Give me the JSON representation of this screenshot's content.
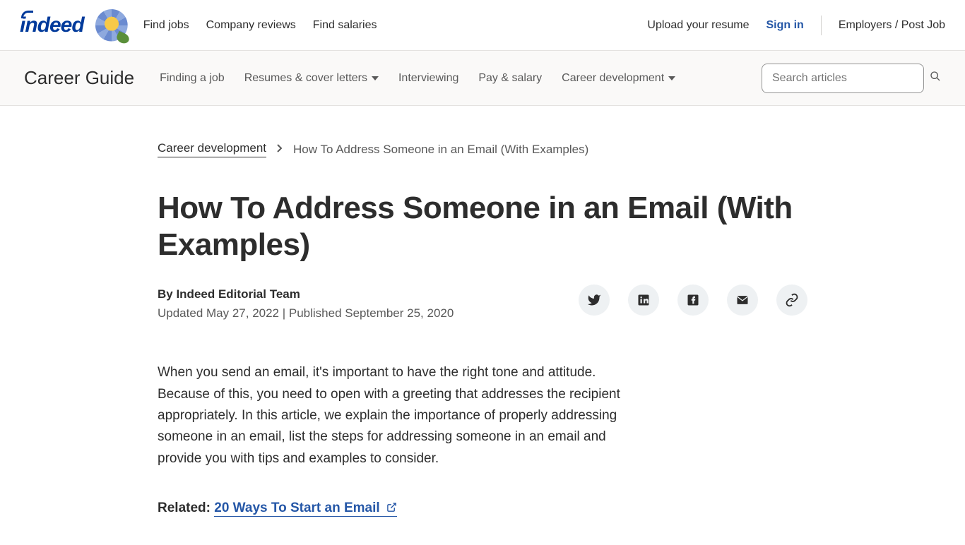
{
  "topNav": {
    "links": [
      "Find jobs",
      "Company reviews",
      "Find salaries"
    ],
    "upload": "Upload your resume",
    "signin": "Sign in",
    "employers": "Employers / Post Job"
  },
  "subNav": {
    "title": "Career Guide",
    "links": [
      {
        "label": "Finding a job",
        "dropdown": false
      },
      {
        "label": "Resumes & cover letters",
        "dropdown": true
      },
      {
        "label": "Interviewing",
        "dropdown": false
      },
      {
        "label": "Pay & salary",
        "dropdown": false
      },
      {
        "label": "Career development",
        "dropdown": true
      }
    ],
    "searchPlaceholder": "Search articles"
  },
  "breadcrumb": {
    "parent": "Career development",
    "current": "How To Address Someone in an Email (With Examples)"
  },
  "article": {
    "title": "How To Address Someone in an Email (With Examples)",
    "byline": "By Indeed Editorial Team",
    "dates": "Updated May 27, 2022 | Published September 25, 2020",
    "body": "When you send an email, it's important to have the right tone and attitude. Because of this, you need to open with a greeting that addresses the recipient appropriately. In this article, we explain the importance of properly addressing someone in an email, list the steps for addressing someone in an email and provide you with tips and examples to consider.",
    "relatedLabel": "Related:",
    "relatedLink": "20 Ways To Start an Email"
  }
}
